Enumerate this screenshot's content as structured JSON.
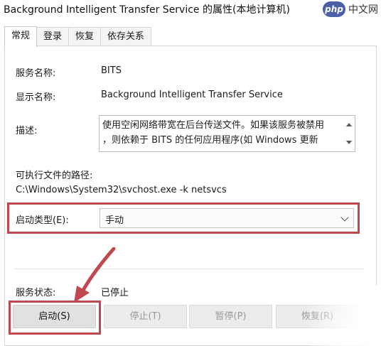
{
  "window": {
    "title": "Background Intelligent Transfer Service 的属性(本地计算机)"
  },
  "watermark": {
    "logo_text": "php",
    "site_text": "中文网"
  },
  "tabs": [
    {
      "label": "常规",
      "active": true
    },
    {
      "label": "登录",
      "active": false
    },
    {
      "label": "恢复",
      "active": false
    },
    {
      "label": "依存关系",
      "active": false
    }
  ],
  "general": {
    "service_name_label": "服务名称:",
    "service_name_value": "BITS",
    "display_name_label": "显示名称:",
    "display_name_value": "Background Intelligent Transfer Service",
    "description_label": "描述:",
    "description_line1": "使用空闲网络带宽在后台传送文件。如果该服务被禁用",
    "description_line2": "，则依赖于 BITS 的任何应用程序(如 Windows 更新",
    "path_label": "可执行文件的路径:",
    "path_value": "C:\\Windows\\System32\\svchost.exe -k netsvcs",
    "startup_type_label": "启动类型(E):",
    "startup_type_value": "手动",
    "service_status_label": "服务状态:",
    "service_status_value": "已停止"
  },
  "buttons": {
    "start": "启动(S)",
    "stop": "停止(T)",
    "pause": "暂停(P)",
    "resume": "恢复(R)"
  },
  "colors": {
    "highlight": "#c0494f",
    "watermark_logo": "#4a5fa8"
  }
}
